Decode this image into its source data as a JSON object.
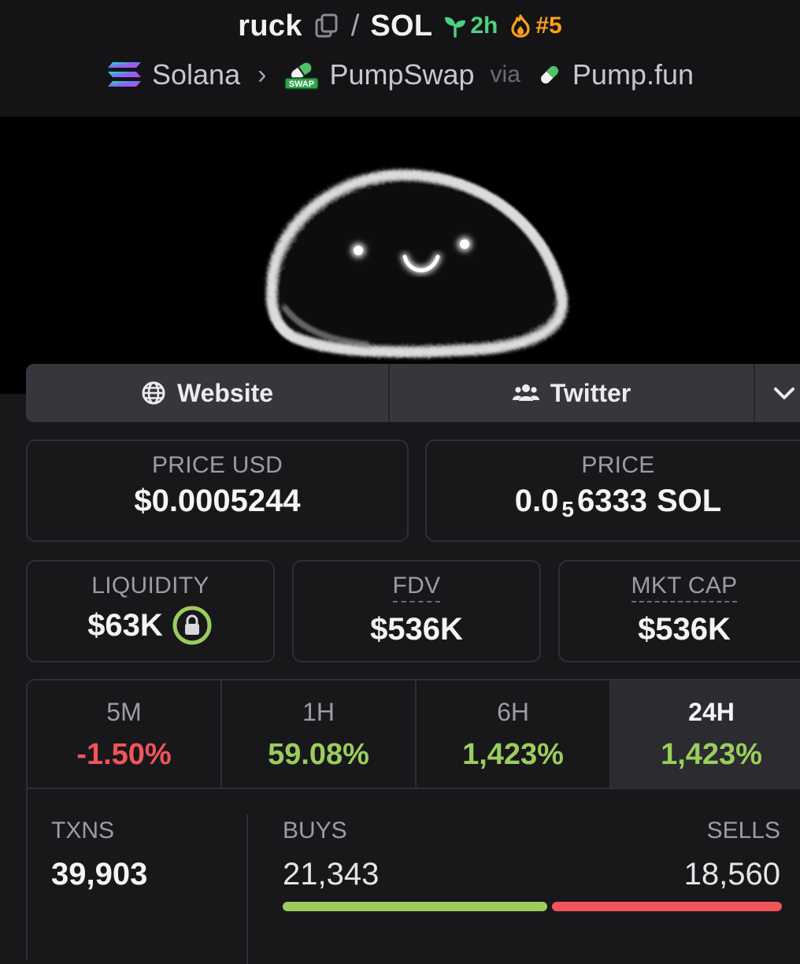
{
  "header": {
    "token_symbol": "ruck",
    "separator": "/",
    "quote_symbol": "SOL",
    "age": "2h",
    "rank": "#5",
    "breadcrumb": {
      "chain": "Solana",
      "dex": "PumpSwap",
      "via_label": "via",
      "launchpad": "Pump.fun",
      "swap_badge": "SWAP"
    }
  },
  "links": {
    "website_label": "Website",
    "twitter_label": "Twitter"
  },
  "price": {
    "usd_label": "PRICE USD",
    "usd_value": "$0.0005244",
    "native_label": "PRICE",
    "native_prefix": "0.0",
    "native_zeros": "5",
    "native_digits": "6333",
    "native_unit": "SOL"
  },
  "stats": {
    "liquidity_label": "LIQUIDITY",
    "liquidity_value": "$63K",
    "fdv_label": "FDV",
    "fdv_value": "$536K",
    "mktcap_label": "MKT CAP",
    "mktcap_value": "$536K"
  },
  "changes": [
    {
      "period": "5M",
      "value": "-1.50%",
      "direction": "down"
    },
    {
      "period": "1H",
      "value": "59.08%",
      "direction": "up"
    },
    {
      "period": "6H",
      "value": "1,423%",
      "direction": "up"
    },
    {
      "period": "24H",
      "value": "1,423%",
      "direction": "up",
      "active": true
    }
  ],
  "txns": {
    "label": "TXNS",
    "total": "39,903",
    "buys_label": "BUYS",
    "buys": "21,343",
    "sells_label": "SELLS",
    "sells": "18,560",
    "buy_ratio": 0.535
  },
  "colors": {
    "up": "#9bcd5c",
    "down": "#f0555a",
    "age": "#4fd07f",
    "rank": "#ff9f1c",
    "lock_ring": "#9bcd5c"
  }
}
